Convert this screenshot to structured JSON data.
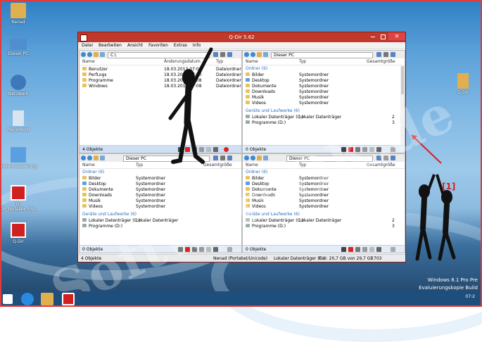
{
  "desktop": {
    "icons": [
      {
        "name": "user-folder-icon",
        "label": "Nenad",
        "color": "#e0b050"
      },
      {
        "name": "this-pc-icon",
        "label": "Dieser PC",
        "color": "#4f8fd0"
      },
      {
        "name": "network-icon",
        "label": "Netzwerk",
        "color": "#3f78b8"
      },
      {
        "name": "recycle-bin-icon",
        "label": "Papierkorb",
        "color": "#d8e4ee"
      },
      {
        "name": "control-panel-icon",
        "label": "Systemsteuerung",
        "color": "#5aa0e0"
      },
      {
        "name": "qdir-installer-icon",
        "label": "Q-Dir_Installer_Uni...",
        "color": "#d02020"
      },
      {
        "name": "qdir-icon",
        "label": "Q-Dir",
        "color": "#d02020"
      }
    ],
    "right_icon": {
      "label": "Q-Dir"
    },
    "os_text_line1": "Windows 8.1 Pro Pre",
    "os_text_line2": "Evaluierungskopie Build",
    "clock": "07:2"
  },
  "window": {
    "title": "Q-Dir 5.62",
    "menu": [
      "Datei",
      "Bearbeiten",
      "Ansicht",
      "Favoriten",
      "Extras",
      "Info"
    ],
    "status": {
      "count": "4 Objekte",
      "user": "Nenad (Portabel/Unicode)",
      "drive": "Lokaler Datenträger (C:)",
      "free": "Frei: 20,7 GB von 29,7 GB",
      "num": "703"
    }
  },
  "panes": {
    "tl": {
      "address": "C:\\",
      "columns": [
        "Name",
        "Änderungsdatum",
        "Typ"
      ],
      "rows": [
        {
          "name": "Benutzer",
          "date": "18.03.2013 07:08",
          "type": "Dateiordner"
        },
        {
          "name": "PerfLogs",
          "date": "18.03.2013 07:30",
          "type": "Dateiordner"
        },
        {
          "name": "Programme",
          "date": "18.03.2013 07:08",
          "type": "Dateiordner"
        },
        {
          "name": "Windows",
          "date": "18.03.2013 07:08",
          "type": "Dateiordner"
        }
      ],
      "status": "4 Objekte"
    },
    "tr": {
      "address": "Dieser PC",
      "columns": [
        "Name",
        "Typ",
        "Gesamtgröße"
      ],
      "group1": "Ordner (6)",
      "rows": [
        {
          "name": "Bilder",
          "type": "Systemordner"
        },
        {
          "name": "Desktop",
          "type": "Systemordner"
        },
        {
          "name": "Dokumente",
          "type": "Systemordner"
        },
        {
          "name": "Downloads",
          "type": "Systemordner"
        },
        {
          "name": "Musik",
          "type": "Systemordner"
        },
        {
          "name": "Videos",
          "type": "Systemordner"
        }
      ],
      "group2": "Geräte und Laufwerke (6)",
      "drives": [
        {
          "name": "Lokaler Datenträger (C:)",
          "type": "Lokaler Datenträger",
          "size": "2"
        },
        {
          "name": "Programme (D:)",
          "type": "",
          "size": "3"
        }
      ],
      "status": "0 Objekte"
    },
    "bl": {
      "address": "Dieser PC",
      "columns": [
        "Name",
        "Typ",
        "Gesamtgröße"
      ],
      "group1": "Ordner (6)",
      "rows": [
        {
          "name": "Bilder",
          "type": "Systemordner"
        },
        {
          "name": "Desktop",
          "type": "Systemordner"
        },
        {
          "name": "Dokumente",
          "type": "Systemordner"
        },
        {
          "name": "Downloads",
          "type": "Systemordner"
        },
        {
          "name": "Musik",
          "type": "Systemordner"
        },
        {
          "name": "Videos",
          "type": "Systemordner"
        }
      ],
      "group2": "Geräte und Laufwerke (6)",
      "drives": [
        {
          "name": "Lokaler Datenträger (C:)",
          "type": "Lokaler Datenträger",
          "size": ""
        },
        {
          "name": "Programme (D:)",
          "type": "",
          "size": ""
        }
      ],
      "status": "0 Objekte"
    },
    "br": {
      "address": "Dieser PC",
      "columns": [
        "Name",
        "Typ",
        "Gesamtgröße"
      ],
      "group1": "Ordner (6)",
      "rows": [
        {
          "name": "Bilder",
          "type": "Systemordner"
        },
        {
          "name": "Desktop",
          "type": "Systemordner"
        },
        {
          "name": "Dokumente",
          "type": "Systemordner"
        },
        {
          "name": "Downloads",
          "type": "Systemordner"
        },
        {
          "name": "Musik",
          "type": "Systemordner"
        },
        {
          "name": "Videos",
          "type": "Systemordner"
        }
      ],
      "group2": "Geräte und Laufwerke (6)",
      "drives": [
        {
          "name": "Lokaler Datenträger (C:)",
          "type": "Lokaler Datenträger",
          "size": "2"
        },
        {
          "name": "Programme (D:)",
          "type": "",
          "size": "3"
        }
      ],
      "status": "0 Objekte"
    }
  },
  "annotation": {
    "label": "[1]",
    "watermark": "SoftwareOK.de"
  }
}
